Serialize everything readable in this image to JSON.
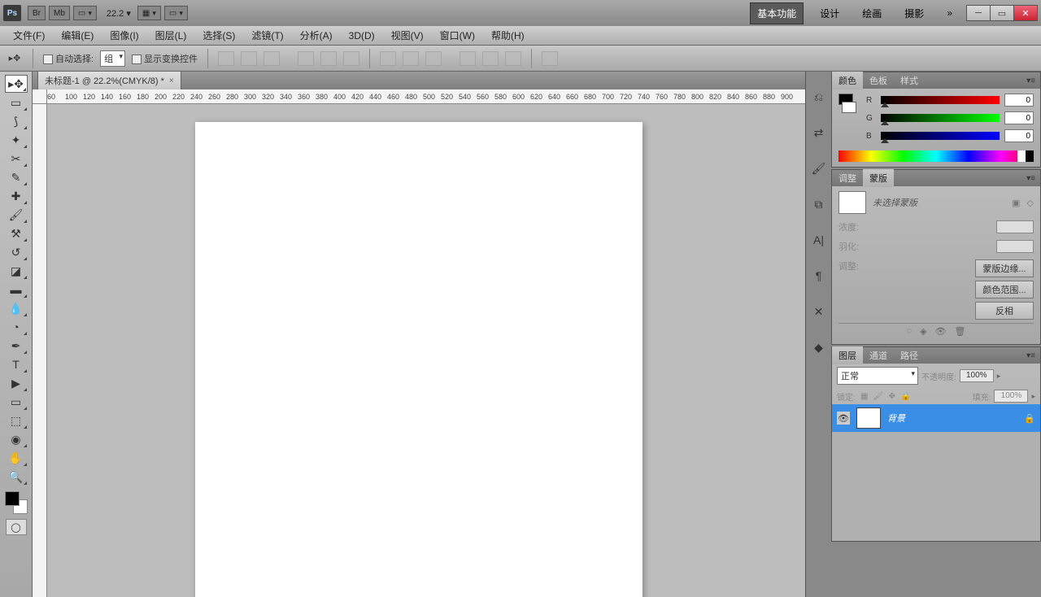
{
  "title": {
    "zoom": "22.2",
    "workspaces": [
      "基本功能",
      "设计",
      "绘画",
      "摄影"
    ]
  },
  "menu": [
    "文件(F)",
    "编辑(E)",
    "图像(I)",
    "图层(L)",
    "选择(S)",
    "滤镜(T)",
    "分析(A)",
    "3D(D)",
    "视图(V)",
    "窗口(W)",
    "帮助(H)"
  ],
  "options": {
    "autoSelect": "自动选择:",
    "group": "组",
    "showTransform": "显示变换控件"
  },
  "doc": {
    "tab": "未标题-1 @ 22.2%(CMYK/8) *"
  },
  "ruler_ticks": [
    "60",
    "100",
    "120",
    "140",
    "160",
    "180",
    "200",
    "220",
    "240",
    "260",
    "280",
    "300",
    "320",
    "340",
    "360",
    "380",
    "400",
    "420",
    "440",
    "460",
    "480",
    "500",
    "520",
    "540",
    "560",
    "580",
    "600",
    "620",
    "640",
    "660",
    "680",
    "700",
    "720",
    "740",
    "760",
    "780",
    "800",
    "820",
    "840",
    "860",
    "880",
    "900"
  ],
  "panels": {
    "color": {
      "tabs": [
        "颜色",
        "色板",
        "样式"
      ],
      "r": "R",
      "g": "G",
      "b": "B",
      "rv": "0",
      "gv": "0",
      "bv": "0"
    },
    "adjust": {
      "tabs": [
        "调整",
        "蒙版"
      ],
      "noMask": "未选择蒙版",
      "density": "浓度:",
      "feather": "羽化:",
      "refine": "调整:",
      "btnEdge": "蒙版边缘...",
      "btnColor": "颜色范围...",
      "btnInvert": "反相"
    },
    "layers": {
      "tabs": [
        "图层",
        "通道",
        "路径"
      ],
      "blend": "正常",
      "opacityLbl": "不透明度:",
      "opacity": "100%",
      "lockLbl": "锁定:",
      "fillLbl": "填充:",
      "fill": "100%",
      "bgLayer": "背景"
    }
  }
}
